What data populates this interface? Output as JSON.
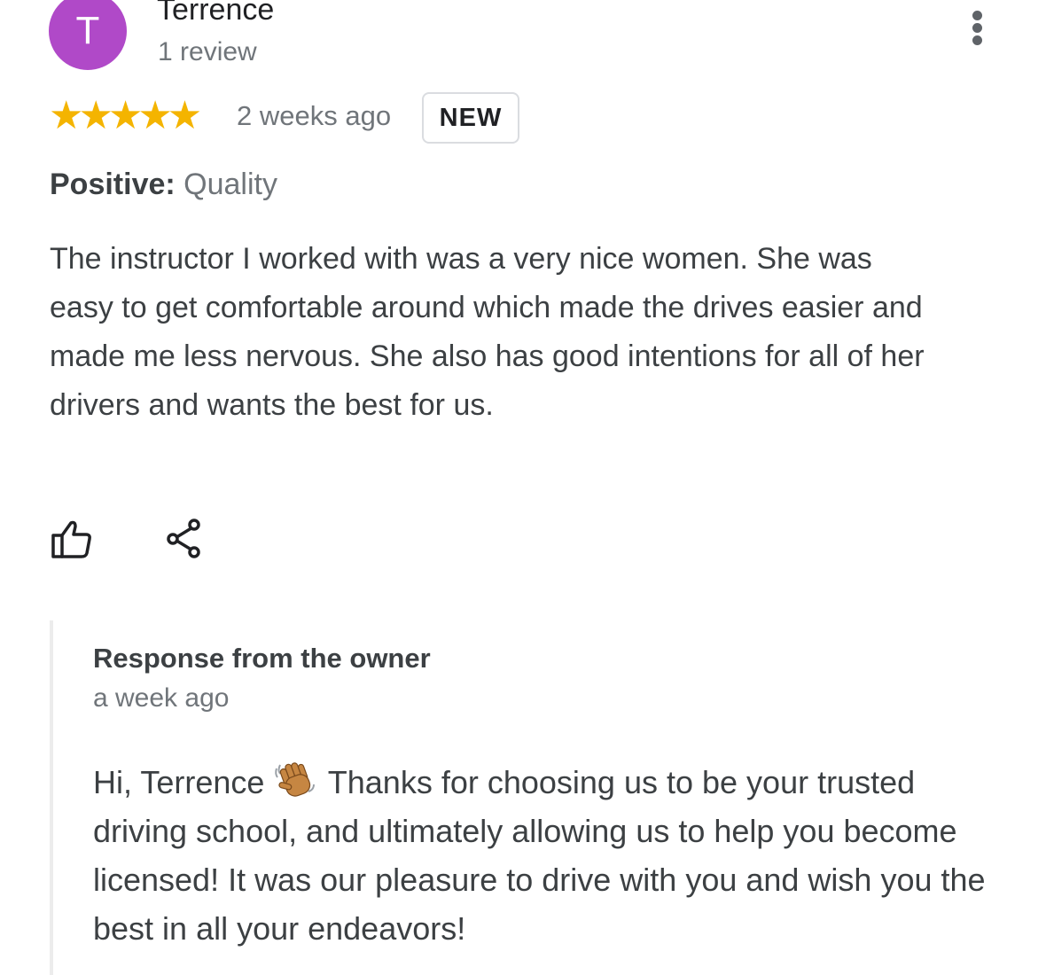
{
  "reviewer": {
    "initial": "T",
    "name": "Terrence",
    "review_count": "1 review",
    "avatar_color": "#b049c8"
  },
  "review": {
    "rating": 5,
    "stars": "★★★★★",
    "star_color": "#f4b400",
    "date": "2 weeks ago",
    "badge": "NEW",
    "attribute_label": "Positive:",
    "attribute_value": "Quality",
    "text": "The instructor I worked with was a very nice women. She was easy to get comfortable around which made the drives easier and made me less nervous. She also has good intentions for all of her drivers and wants the best for us."
  },
  "actions": {
    "like_icon": "thumb-up-icon",
    "share_icon": "share-icon",
    "more_icon": "more-vert-icon"
  },
  "owner_response": {
    "title": "Response from the owner",
    "date": "a week ago",
    "text_before_emoji": "Hi, Terrence ",
    "emoji_icon": "waving-hand-icon",
    "text_after_emoji": " Thanks for choosing us to be your trusted driving school, and ultimately allowing us to help you become licensed! It was our pleasure to drive with you and wish you the best in all your endeavors!"
  }
}
